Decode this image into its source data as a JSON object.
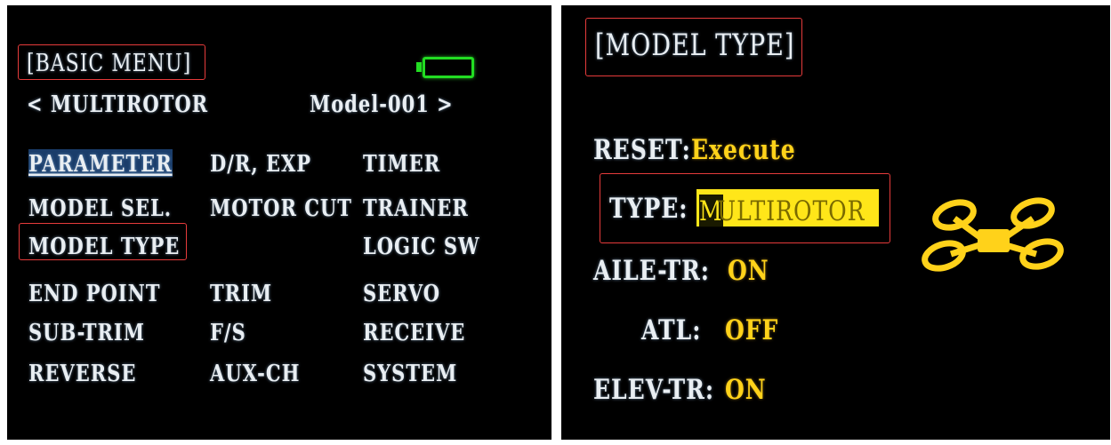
{
  "basic_menu": {
    "title": "[BASIC MENU]",
    "model_type_label": "< MULTIROTOR",
    "model_name": "Model-001 >",
    "battery_color": "#22dd22",
    "items_col1": [
      "PARAMETER",
      "MODEL SEL.",
      "MODEL TYPE",
      "END POINT",
      "SUB-TRIM",
      "REVERSE"
    ],
    "items_col2": [
      "D/R, EXP",
      "MOTOR CUT",
      "",
      "TRIM",
      "F/S",
      "AUX-CH"
    ],
    "items_col3": [
      "TIMER",
      "TRAINER",
      "LOGIC SW",
      "SERVO",
      "RECEIVE",
      "SYSTEM"
    ]
  },
  "model_type_screen": {
    "title": "[MODEL TYPE]",
    "reset_label": "RESET:",
    "reset_value": "Execute",
    "type_label": "TYPE:",
    "type_value_first": "M",
    "type_value_rest": "ULTIROTOR",
    "aile_label": "AILE-TR:",
    "aile_value": "ON",
    "atl_label": "ATL:",
    "atl_value": "OFF",
    "elev_label": "ELEV-TR:",
    "elev_value": "ON",
    "icon": "multirotor-icon",
    "accent_color": "#ffd21a",
    "highlight_color": "#e63b3b"
  }
}
